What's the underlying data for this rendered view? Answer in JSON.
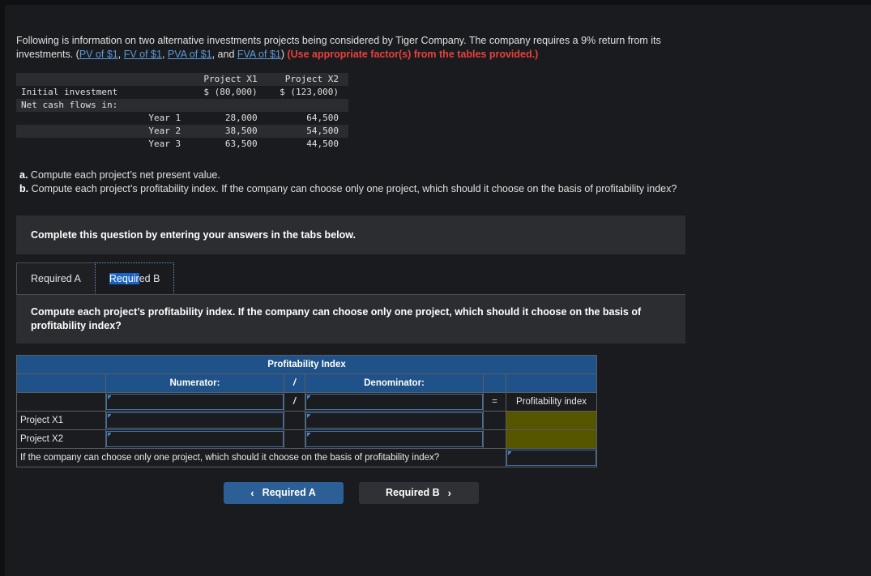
{
  "intro": {
    "sentence1": "Following is information on two alternative investments projects being considered by Tiger Company. The company requires a 9% return from its investments. (",
    "links": [
      "PV of $1",
      "FV of $1",
      "PVA of $1",
      "FVA of $1"
    ],
    "sep1": ", ",
    "sep2": ", ",
    "sep3": ", and ",
    "closeparen": ") ",
    "note": "(Use appropriate factor(s) from the tables provided.)"
  },
  "data_table": {
    "col_headers": [
      "",
      "Project X1",
      "Project X2"
    ],
    "rows": [
      {
        "label": "Initial investment",
        "year": "",
        "x1": "$ (80,000)",
        "x2": "$ (123,000)"
      },
      {
        "label": "Net cash flows in:",
        "year": "",
        "x1": "",
        "x2": ""
      },
      {
        "label": "",
        "year": "Year 1",
        "x1": "28,000",
        "x2": "64,500"
      },
      {
        "label": "",
        "year": "Year 2",
        "x1": "38,500",
        "x2": "54,500"
      },
      {
        "label": "",
        "year": "Year 3",
        "x1": "63,500",
        "x2": "44,500"
      }
    ]
  },
  "questions": {
    "a_marker": "a.",
    "a_text": " Compute each project’s net present value.",
    "b_marker": "b.",
    "b_text": " Compute each project’s profitability index. If the company can choose only one project, which should it choose on the basis of profitability index?"
  },
  "banner": {
    "text": "Complete this question by entering your answers in the tabs below."
  },
  "tabs": {
    "items": [
      {
        "label": "Required A",
        "active": false
      },
      {
        "label_selected": "Requir",
        "label_rest": "ed B",
        "active": true
      }
    ]
  },
  "tab_prompt": {
    "text": "Compute each project’s profitability index. If the company can choose only one project, which should it choose on the basis of profitability index?"
  },
  "pi_table": {
    "title": "Profitability Index",
    "header": {
      "blank1": "",
      "numerator": "Numerator:",
      "slash": "/",
      "denominator": "Denominator:",
      "blank2": "",
      "blank3": ""
    },
    "formula_row": {
      "label": "",
      "slash": "/",
      "equals": "=",
      "result_label": "Profitability index"
    },
    "rows": [
      {
        "label": "Project X1"
      },
      {
        "label": "Project X2"
      }
    ],
    "final_question": "If the company can choose only one project, which should it choose on the basis of profitability index?"
  },
  "nav": {
    "prev_chevron": "‹",
    "prev_label": "Required A",
    "next_label": "Required B",
    "next_chevron": "›"
  },
  "colors": {
    "header_blue": "#1f5288",
    "result_olive": "#565500",
    "link_blue": "#5b9ad6",
    "note_red": "#e8413c",
    "selection_blue": "#1b64c4",
    "active_button": "#2c5f96"
  }
}
